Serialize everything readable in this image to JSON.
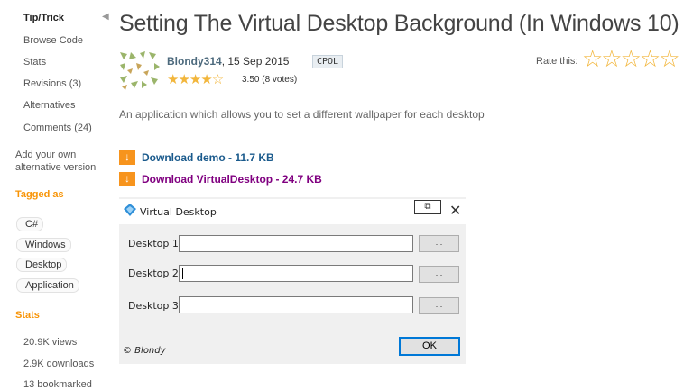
{
  "sidebar": {
    "section_title": "Tip/Trick",
    "items": [
      {
        "label": "Browse Code"
      },
      {
        "label": "Stats"
      },
      {
        "label": "Revisions (3)"
      },
      {
        "label": "Alternatives"
      },
      {
        "label": "Comments (24)"
      }
    ],
    "add_alternative": "Add your own alternative version",
    "tagged_as": "Tagged as",
    "tags": [
      "C#",
      "Windows",
      "Desktop",
      "Application"
    ],
    "stats_header": "Stats",
    "stats": [
      "20.9K views",
      "2.9K downloads",
      "13 bookmarked"
    ]
  },
  "article": {
    "title": "Setting The Virtual Desktop Background (In Windows 10)",
    "author": "Blondy314",
    "date": ", 15 Sep 2015",
    "license": "CPOL",
    "stars": "★★★★☆",
    "rating_text": "3.50 (8 votes)",
    "rate_label": "Rate this:",
    "rate_stars": "☆☆☆☆☆",
    "summary": "An application which allows you to set a different wallpaper for each desktop",
    "downloads": [
      {
        "label": "Download demo - 11.7 KB",
        "color": "#1a5a8c"
      },
      {
        "label": "Download VirtualDesktop - 24.7 KB",
        "color": "#800080"
      }
    ]
  },
  "dialog": {
    "title": "Virtual Desktop",
    "rows": [
      {
        "label": "Desktop 1:",
        "value": "",
        "button": "..."
      },
      {
        "label": "Desktop 2:",
        "value": "",
        "button": "..."
      },
      {
        "label": "Desktop 3:",
        "value": "",
        "button": "..."
      }
    ],
    "ok_label": "OK",
    "copyright": "© Blondy"
  },
  "colors": {
    "accent": "#f89406",
    "link_blue": "#1a5a8c",
    "link_purple": "#800080",
    "ok_border": "#0078d7"
  }
}
